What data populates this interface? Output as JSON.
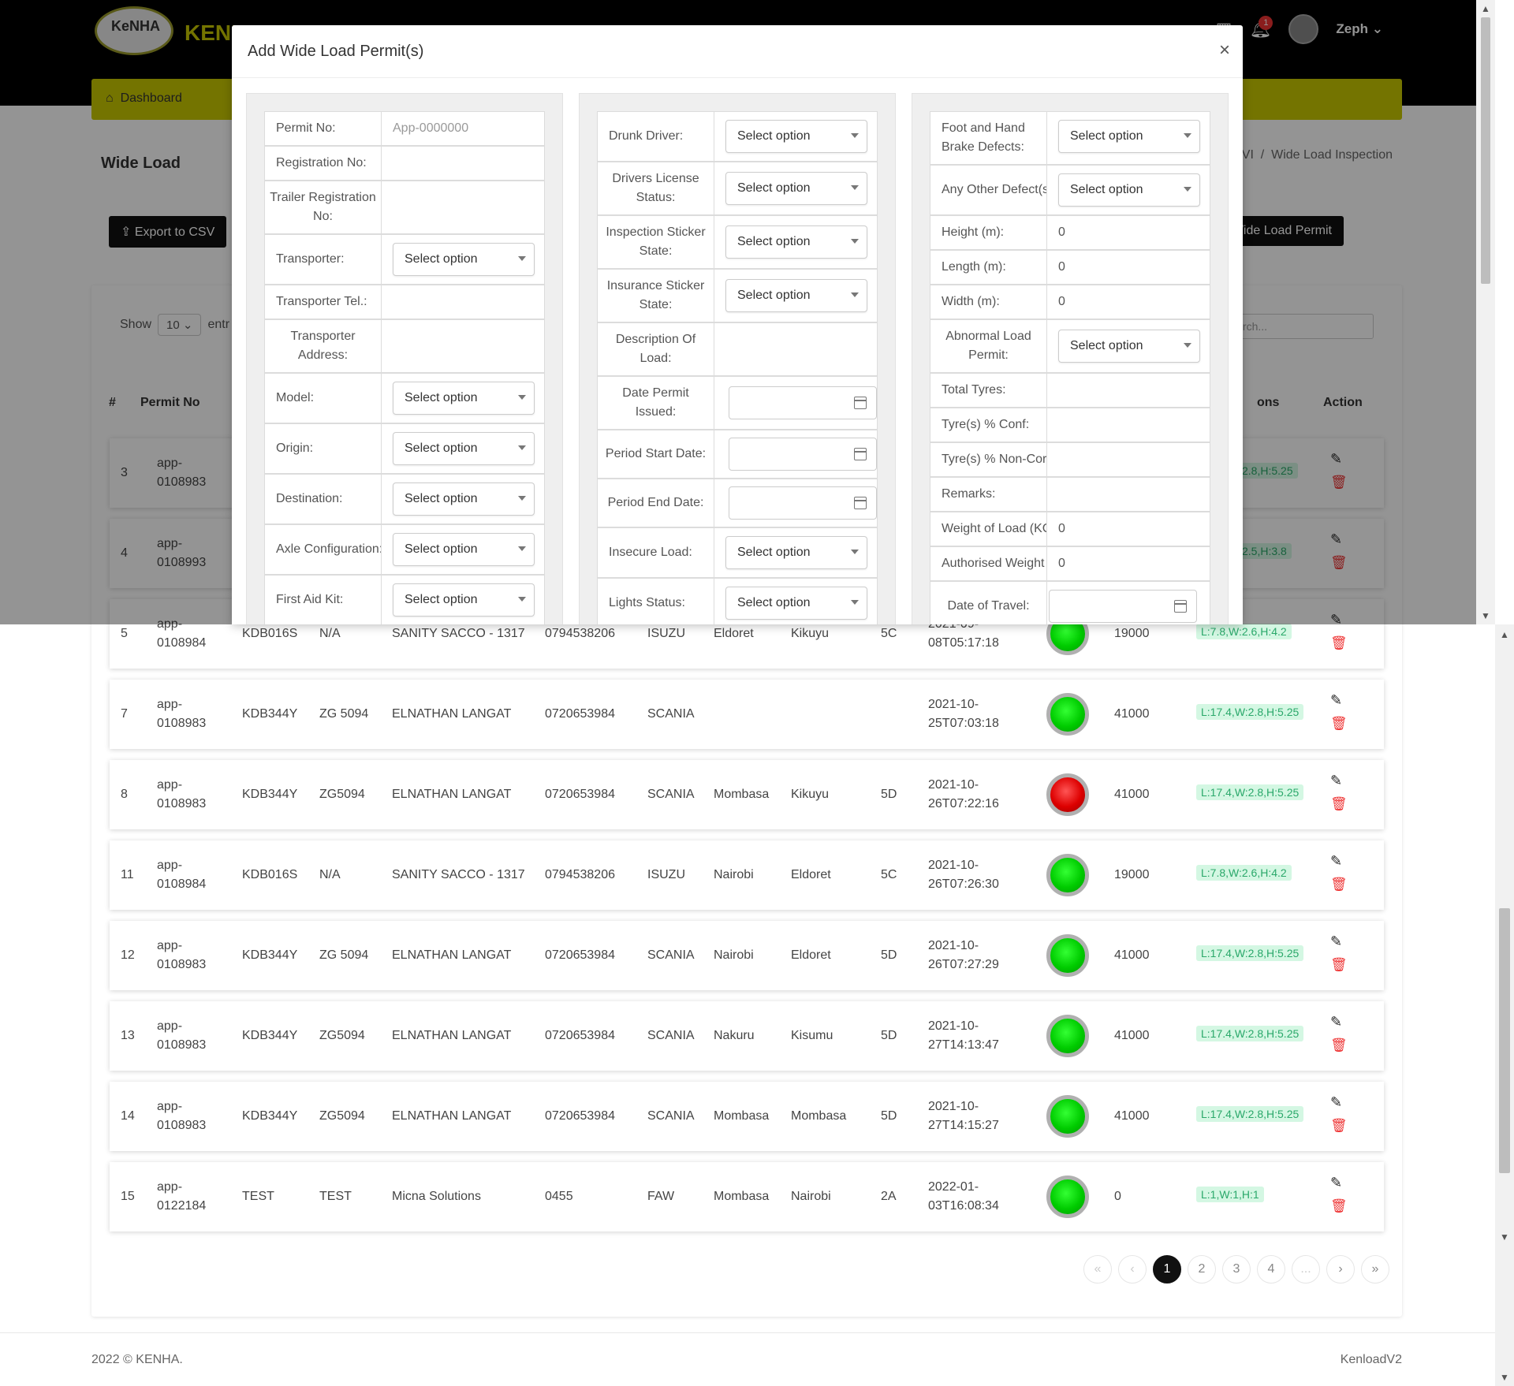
{
  "app": {
    "logo_text": "KeNHA",
    "brand_text": "KENL",
    "user_name": "Zeph",
    "notification_count": "1",
    "nav_dashboard": "Dashboard"
  },
  "page": {
    "title": "Wide Load",
    "breadcrumb_prev": "VI",
    "breadcrumb_sep": "/",
    "breadcrumb_current": "Wide Load Inspection",
    "export_label": "Export to CSV",
    "add_label": "/ide Load Permit",
    "show_label": "Show",
    "show_value": "10",
    "entries_label": "entr",
    "search_placeholder": "Search..."
  },
  "table": {
    "headers": {
      "num": "#",
      "permit": "Permit No",
      "options": "ons",
      "action": "Action"
    },
    "rows": [
      {
        "num": "3",
        "permit_a": "app-",
        "permit_b": "0108983",
        "badge": "2.8,H:5.25",
        "status": "green"
      },
      {
        "num": "4",
        "permit_a": "app-",
        "permit_b": "0108993",
        "badge": "2.5,H:3.8",
        "status": "green"
      },
      {
        "num": "5",
        "permit_a": "app-",
        "permit_b": "0108984",
        "reg": "KDB016S",
        "trailer": "N/A",
        "transporter": "SANITY SACCO - 1317",
        "tel": "0794538206",
        "model": "ISUZU",
        "origin": "Eldoret",
        "dest": "Kikuyu",
        "axle": "5C",
        "date_a": "2021-09-",
        "date_b": "08T05:17:18",
        "weight": "19000",
        "badge": "L:7.8,W:2.6,H:4.2",
        "status": "green"
      },
      {
        "num": "7",
        "permit_a": "app-",
        "permit_b": "0108983",
        "reg": "KDB344Y",
        "trailer": "ZG 5094",
        "transporter": "ELNATHAN LANGAT",
        "tel": "0720653984",
        "model": "SCANIA",
        "origin": "",
        "dest": "",
        "axle": "",
        "date_a": "2021-10-",
        "date_b": "25T07:03:18",
        "weight": "41000",
        "badge": "L:17.4,W:2.8,H:5.25",
        "status": "green"
      },
      {
        "num": "8",
        "permit_a": "app-",
        "permit_b": "0108983",
        "reg": "KDB344Y",
        "trailer": "ZG5094",
        "transporter": "ELNATHAN LANGAT",
        "tel": "0720653984",
        "model": "SCANIA",
        "origin": "Mombasa",
        "dest": "Kikuyu",
        "axle": "5D",
        "date_a": "2021-10-",
        "date_b": "26T07:22:16",
        "weight": "41000",
        "badge": "L:17.4,W:2.8,H:5.25",
        "status": "red"
      },
      {
        "num": "11",
        "permit_a": "app-",
        "permit_b": "0108984",
        "reg": "KDB016S",
        "trailer": "N/A",
        "transporter": "SANITY SACCO - 1317",
        "tel": "0794538206",
        "model": "ISUZU",
        "origin": "Nairobi",
        "dest": "Eldoret",
        "axle": "5C",
        "date_a": "2021-10-",
        "date_b": "26T07:26:30",
        "weight": "19000",
        "badge": "L:7.8,W:2.6,H:4.2",
        "status": "green"
      },
      {
        "num": "12",
        "permit_a": "app-",
        "permit_b": "0108983",
        "reg": "KDB344Y",
        "trailer": "ZG 5094",
        "transporter": "ELNATHAN LANGAT",
        "tel": "0720653984",
        "model": "SCANIA",
        "origin": "Nairobi",
        "dest": "Eldoret",
        "axle": "5D",
        "date_a": "2021-10-",
        "date_b": "26T07:27:29",
        "weight": "41000",
        "badge": "L:17.4,W:2.8,H:5.25",
        "status": "green"
      },
      {
        "num": "13",
        "permit_a": "app-",
        "permit_b": "0108983",
        "reg": "KDB344Y",
        "trailer": "ZG5094",
        "transporter": "ELNATHAN LANGAT",
        "tel": "0720653984",
        "model": "SCANIA",
        "origin": "Nakuru",
        "dest": "Kisumu",
        "axle": "5D",
        "date_a": "2021-10-",
        "date_b": "27T14:13:47",
        "weight": "41000",
        "badge": "L:17.4,W:2.8,H:5.25",
        "status": "green"
      },
      {
        "num": "14",
        "permit_a": "app-",
        "permit_b": "0108983",
        "reg": "KDB344Y",
        "trailer": "ZG5094",
        "transporter": "ELNATHAN LANGAT",
        "tel": "0720653984",
        "model": "SCANIA",
        "origin": "Mombasa",
        "dest": "Mombasa",
        "axle": "5D",
        "date_a": "2021-10-",
        "date_b": "27T14:15:27",
        "weight": "41000",
        "badge": "L:17.4,W:2.8,H:5.25",
        "status": "green"
      },
      {
        "num": "15",
        "permit_a": "app-",
        "permit_b": "0122184",
        "reg": "TEST",
        "trailer": "TEST",
        "transporter": "Micna Solutions",
        "tel": "0455",
        "model": "FAW",
        "origin": "Mombasa",
        "dest": "Nairobi",
        "axle": "2A",
        "date_a": "2022-01-",
        "date_b": "03T16:08:34",
        "weight": "0",
        "badge": "L:1,W:1,H:1",
        "status": "green"
      }
    ]
  },
  "pagination": {
    "first": "«",
    "prev": "‹",
    "p1": "1",
    "p2": "2",
    "p3": "3",
    "p4": "4",
    "ellipsis": "...",
    "next": "›",
    "last": "»",
    "current": 1
  },
  "footer": {
    "copyright": "2022 © KENHA.",
    "version": "KenloadV2"
  },
  "modal": {
    "title": "Add Wide Load Permit(s)",
    "close": "×",
    "select_placeholder": "Select option",
    "col1": {
      "permit_no_label": "Permit No:",
      "permit_no_placeholder": "App-0000000",
      "reg_label": "Registration No:",
      "trailer_label": "Trailer Registration No:",
      "transporter_label": "Transporter:",
      "transporter_tel_label": "Transporter Tel.:",
      "transporter_address_label": "Transporter Address:",
      "model_label": "Model:",
      "origin_label": "Origin:",
      "destination_label": "Destination:",
      "axle_label": "Axle Configuration:",
      "first_aid_label": "First Aid Kit:"
    },
    "col2": {
      "drunk_label": "Drunk Driver:",
      "license_label": "Drivers License Status:",
      "inspection_label": "Inspection Sticker State:",
      "insurance_label": "Insurance Sticker State:",
      "description_label": "Description Of Load:",
      "date_issued_label": "Date Permit Issued:",
      "start_label": "Period Start Date:",
      "end_label": "Period End Date:",
      "insecure_label": "Insecure Load:",
      "lights_label": "Lights Status:"
    },
    "col3": {
      "brake_label": "Foot and Hand Brake Defects:",
      "other_label": "Any Other Defect(s",
      "height_label": "Height (m):",
      "height_value": "0",
      "length_label": "Length (m):",
      "length_value": "0",
      "width_label": "Width (m):",
      "width_value": "0",
      "abnormal_label": "Abnormal Load Permit:",
      "tyres_label": "Total Tyres:",
      "conf_label": "Tyre(s) % Conf:",
      "nonconf_label": "Tyre(s) % Non-Cor",
      "remarks_label": "Remarks:",
      "weight_label": "Weight of Load (KC",
      "weight_value": "0",
      "auth_weight_label": "Authorised Weight",
      "auth_weight_value": "0",
      "travel_label": "Date of Travel:"
    }
  },
  "colors": {
    "navbar": "#c9c900",
    "brand": "#c8c800",
    "badge_bg": "#d4f7e3",
    "badge_fg": "#2aa86a",
    "danger": "#e33",
    "status_green": "#00cc00",
    "status_red": "#dd0000"
  }
}
